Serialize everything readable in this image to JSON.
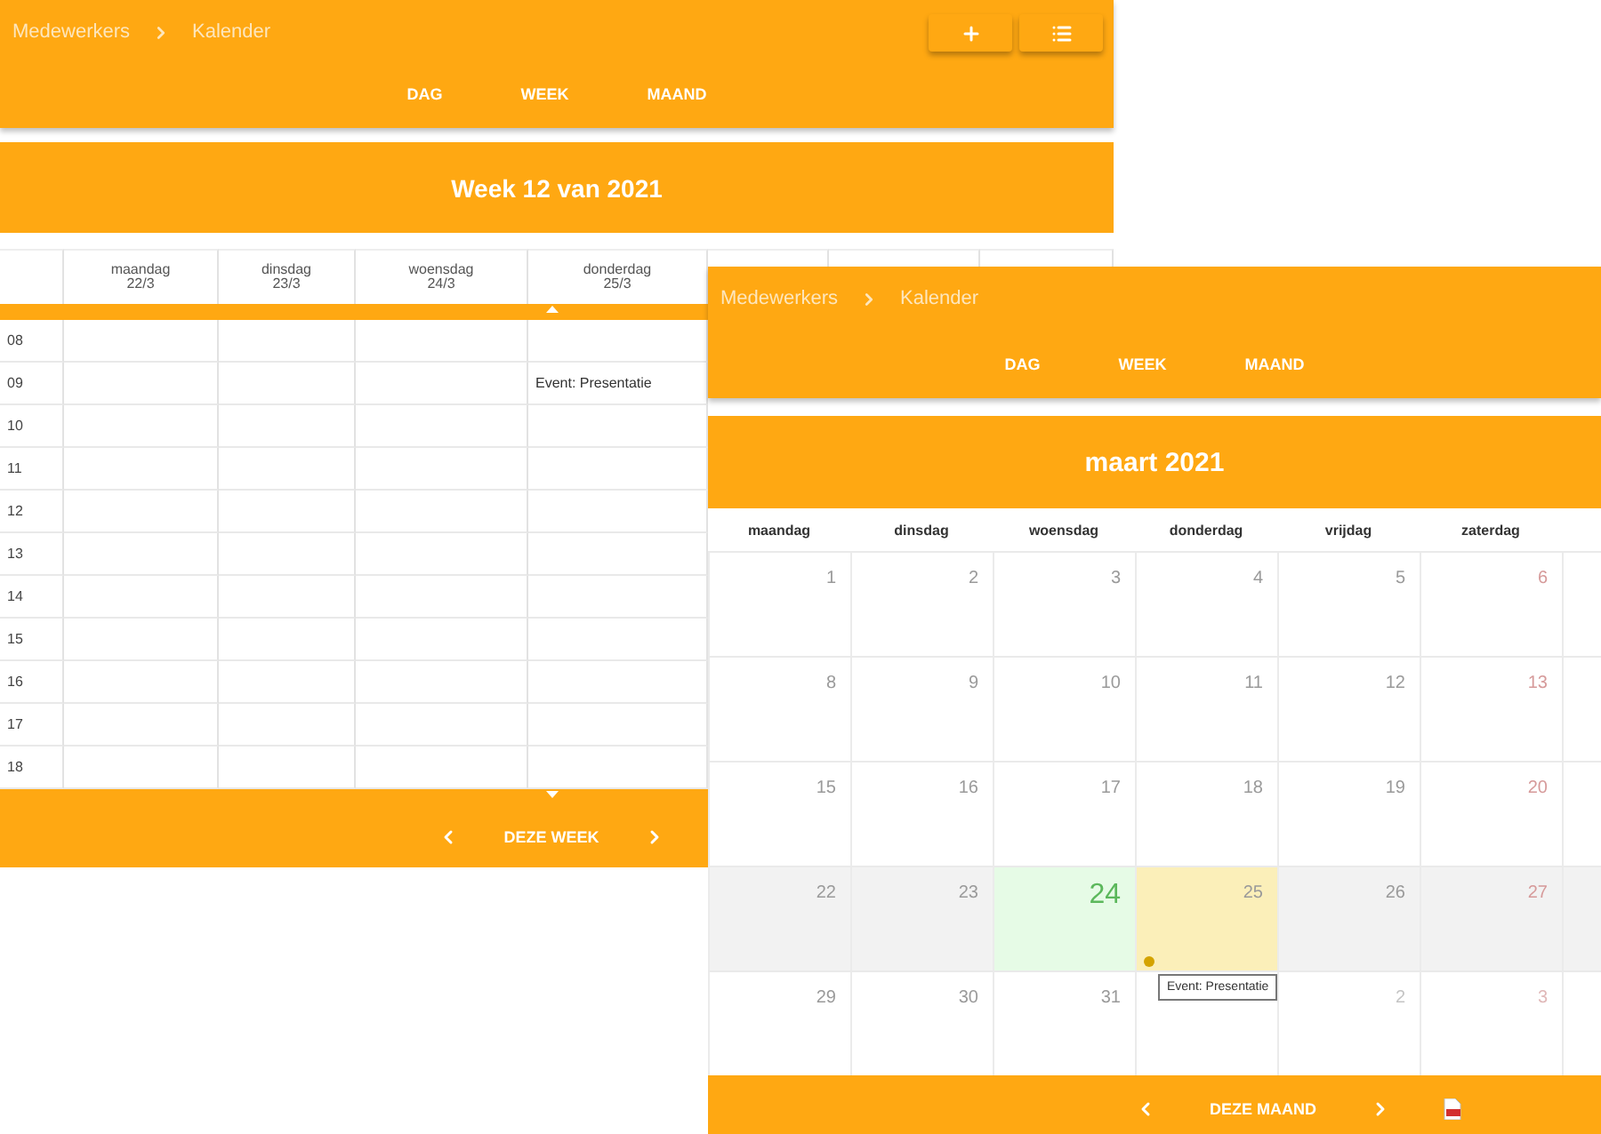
{
  "week_view": {
    "breadcrumb": [
      "Medewerkers",
      "Kalender"
    ],
    "buttons": [
      {
        "kind": "add"
      },
      {
        "kind": "list"
      }
    ],
    "tabs": [
      "DAG",
      "WEEK",
      "MAAND"
    ],
    "title": "Week 12 van 2021",
    "columns": [
      {
        "day": "maandag",
        "date": "22/3"
      },
      {
        "day": "dinsdag",
        "date": "23/3"
      },
      {
        "day": "woensdag",
        "date": "24/3"
      },
      {
        "day": "donderdag",
        "date": "25/3"
      }
    ],
    "rows": [
      {
        "hour": "08"
      },
      {
        "hour": "09",
        "cells": [
          null,
          null,
          null,
          "Event: Presentatie"
        ]
      },
      {
        "hour": "10"
      },
      {
        "hour": "11"
      },
      {
        "hour": "12"
      },
      {
        "hour": "13"
      },
      {
        "hour": "14"
      },
      {
        "hour": "15"
      },
      {
        "hour": "16"
      },
      {
        "hour": "17"
      },
      {
        "hour": "18"
      }
    ],
    "footer_label": "DEZE WEEK"
  },
  "month_view": {
    "breadcrumb": [
      "Medewerkers",
      "Kalender"
    ],
    "tabs": [
      "DAG",
      "WEEK",
      "MAAND"
    ],
    "title": "maart 2021",
    "weekdays": [
      "maandag",
      "dinsdag",
      "woensdag",
      "donderdag",
      "vrijdag",
      "zaterdag"
    ],
    "weeks": [
      {
        "current": false,
        "days": [
          {
            "label": "1",
            "weekend": false,
            "outside": false,
            "today": false,
            "event": false
          },
          {
            "label": "2",
            "weekend": false,
            "outside": false,
            "today": false,
            "event": false
          },
          {
            "label": "3",
            "weekend": false,
            "outside": false,
            "today": false,
            "event": false
          },
          {
            "label": "4",
            "weekend": false,
            "outside": false,
            "today": false,
            "event": false
          },
          {
            "label": "5",
            "weekend": false,
            "outside": false,
            "today": false,
            "event": false
          },
          {
            "label": "6",
            "weekend": true,
            "outside": false,
            "today": false,
            "event": false
          }
        ]
      },
      {
        "current": false,
        "days": [
          {
            "label": "8",
            "weekend": false,
            "outside": false,
            "today": false,
            "event": false
          },
          {
            "label": "9",
            "weekend": false,
            "outside": false,
            "today": false,
            "event": false
          },
          {
            "label": "10",
            "weekend": false,
            "outside": false,
            "today": false,
            "event": false
          },
          {
            "label": "11",
            "weekend": false,
            "outside": false,
            "today": false,
            "event": false
          },
          {
            "label": "12",
            "weekend": false,
            "outside": false,
            "today": false,
            "event": false
          },
          {
            "label": "13",
            "weekend": true,
            "outside": false,
            "today": false,
            "event": false
          }
        ]
      },
      {
        "current": false,
        "days": [
          {
            "label": "15",
            "weekend": false,
            "outside": false,
            "today": false,
            "event": false
          },
          {
            "label": "16",
            "weekend": false,
            "outside": false,
            "today": false,
            "event": false
          },
          {
            "label": "17",
            "weekend": false,
            "outside": false,
            "today": false,
            "event": false
          },
          {
            "label": "18",
            "weekend": false,
            "outside": false,
            "today": false,
            "event": false
          },
          {
            "label": "19",
            "weekend": false,
            "outside": false,
            "today": false,
            "event": false
          },
          {
            "label": "20",
            "weekend": true,
            "outside": false,
            "today": false,
            "event": false
          }
        ]
      },
      {
        "current": true,
        "days": [
          {
            "label": "22",
            "weekend": false,
            "outside": false,
            "today": false,
            "event": false
          },
          {
            "label": "23",
            "weekend": false,
            "outside": false,
            "today": false,
            "event": false
          },
          {
            "label": "24",
            "weekend": false,
            "outside": false,
            "today": true,
            "event": false
          },
          {
            "label": "25",
            "weekend": false,
            "outside": false,
            "today": false,
            "event": true
          },
          {
            "label": "26",
            "weekend": false,
            "outside": false,
            "today": false,
            "event": false
          },
          {
            "label": "27",
            "weekend": true,
            "outside": false,
            "today": false,
            "event": false
          }
        ]
      },
      {
        "current": false,
        "days": [
          {
            "label": "29",
            "weekend": false,
            "outside": false,
            "today": false,
            "event": false
          },
          {
            "label": "30",
            "weekend": false,
            "outside": false,
            "today": false,
            "event": false
          },
          {
            "label": "31",
            "weekend": false,
            "outside": false,
            "today": false,
            "event": false
          },
          {
            "today": false,
            "event": false
          },
          {
            "label": "2",
            "weekend": false,
            "outside": true,
            "today": false,
            "event": false
          },
          {
            "label": "3",
            "weekend": true,
            "outside": true,
            "today": false,
            "event": false
          }
        ]
      }
    ],
    "tooltip": "Event: Presentatie",
    "footer_label": "DEZE MAAND"
  }
}
